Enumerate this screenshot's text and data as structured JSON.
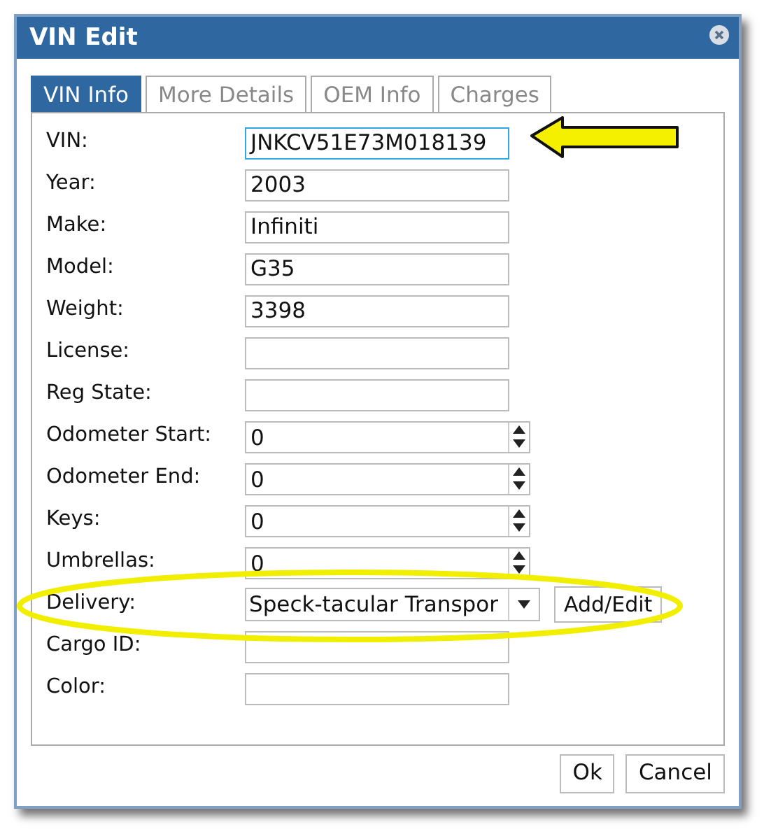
{
  "window": {
    "title": "VIN Edit"
  },
  "tabs": [
    {
      "label": "VIN Info",
      "selected": true
    },
    {
      "label": "More Details",
      "selected": false
    },
    {
      "label": "OEM Info",
      "selected": false
    },
    {
      "label": "Charges",
      "selected": false
    }
  ],
  "fields": [
    {
      "label": "VIN:",
      "kind": "text",
      "value": "JNKCV51E73M018139",
      "focused": true
    },
    {
      "label": "Year:",
      "kind": "text",
      "value": "2003",
      "focused": false
    },
    {
      "label": "Make:",
      "kind": "text",
      "value": "Infiniti",
      "focused": false
    },
    {
      "label": "Model:",
      "kind": "text",
      "value": "G35",
      "focused": false
    },
    {
      "label": "Weight:",
      "kind": "text",
      "value": "3398",
      "focused": false
    },
    {
      "label": "License:",
      "kind": "text",
      "focused": false
    },
    {
      "label": "Reg State:",
      "kind": "text",
      "focused": false
    },
    {
      "label": "Odometer Start:",
      "kind": "number",
      "value": "0",
      "focused": false
    },
    {
      "label": "Odometer End:",
      "kind": "number",
      "value": "0",
      "focused": false
    },
    {
      "label": "Keys:",
      "kind": "number",
      "value": "0",
      "focused": false
    },
    {
      "label": "Umbrellas:",
      "kind": "number",
      "value": "0",
      "focused": false
    },
    {
      "label": "Delivery:",
      "kind": "select",
      "value": "Speck-tacular Transpor",
      "button": "Add/Edit",
      "focused": false
    },
    {
      "label": "Cargo ID:",
      "kind": "text",
      "focused": false
    },
    {
      "label": "Color:",
      "kind": "text",
      "focused": false
    }
  ],
  "buttons": [
    "Ok",
    "Cancel"
  ]
}
